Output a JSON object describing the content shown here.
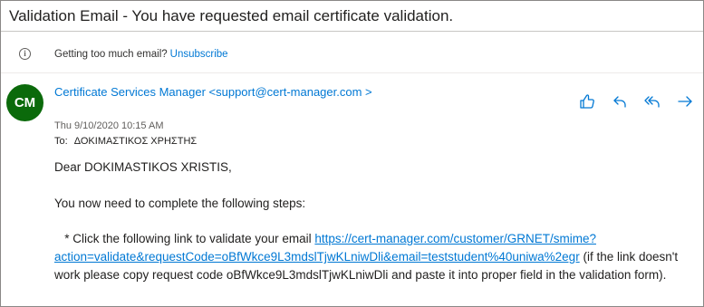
{
  "email": {
    "subject": "Validation Email - You have requested email certificate validation.",
    "notice": {
      "icon": "info-icon",
      "text": "Getting too much email?",
      "link_label": "Unsubscribe"
    },
    "sender": {
      "initials": "CM",
      "avatar_color": "#0b6a0b",
      "display": "Certificate Services Manager <support@cert-manager.com >"
    },
    "date": "Thu 9/10/2020 10:15 AM",
    "to": {
      "label": "To:",
      "recipient": "ΔΟΚΙΜΑΣΤΙΚΟΣ ΧΡΗΣΤΗΣ"
    },
    "actions": [
      {
        "name": "like-icon"
      },
      {
        "name": "reply-icon"
      },
      {
        "name": "reply-all-icon"
      },
      {
        "name": "forward-icon"
      }
    ],
    "body": {
      "greeting": "Dear DOKIMASTIKOS XRISTIS,",
      "intro": "You now need to complete the following steps:",
      "step1_prefix": "* Click the following link to validate your email ",
      "step1_link": "https://cert-manager.com/customer/GRNET/smime?action=validate&requestCode=oBfWkce9L3mdslTjwKLniwDli&email=teststudent%40uniwa%2egr",
      "step1_suffix": " (if the link doesn't work please copy request code oBfWkce9L3mdslTjwKLniwDli and paste it into proper field in the validation form)."
    }
  },
  "colors": {
    "accent": "#0078d4",
    "text": "#201f1e",
    "muted": "#605e5c",
    "avatar": "#0b6a0b"
  }
}
